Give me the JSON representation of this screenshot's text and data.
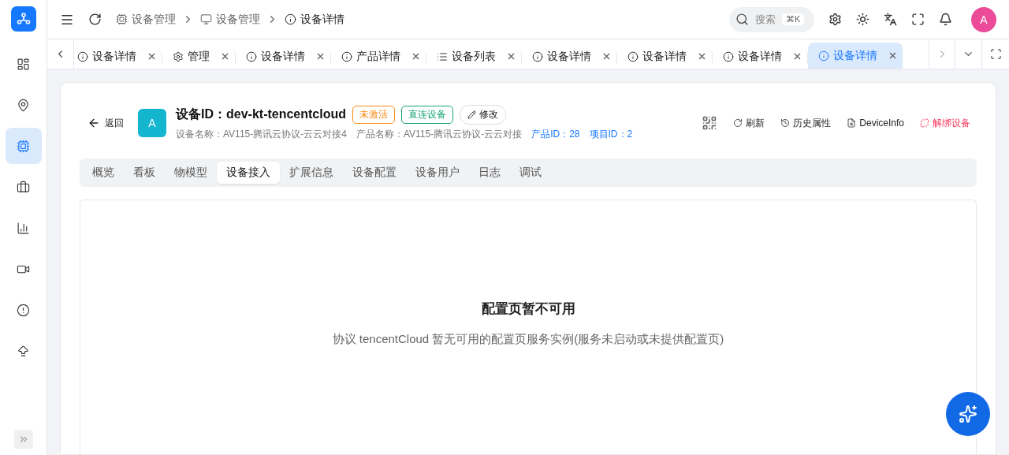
{
  "sidebar": {
    "items": [
      {
        "selected": false
      },
      {
        "selected": false
      },
      {
        "selected": true
      },
      {
        "selected": false
      },
      {
        "selected": false
      },
      {
        "selected": false
      },
      {
        "selected": false
      },
      {
        "selected": false
      }
    ]
  },
  "breadcrumb": [
    {
      "label": "设备管理"
    },
    {
      "label": "设备管理"
    },
    {
      "label": "设备详情"
    }
  ],
  "search": {
    "placeholder": "搜索",
    "shortcut": "⌘K"
  },
  "avatar": "A",
  "tabs": [
    {
      "kind": "info",
      "label": "设备详情",
      "selected": false
    },
    {
      "kind": "gear",
      "label": "管理",
      "selected": false
    },
    {
      "kind": "info",
      "label": "设备详情",
      "selected": false
    },
    {
      "kind": "info",
      "label": "产品详情",
      "selected": false
    },
    {
      "kind": "list",
      "label": "设备列表",
      "selected": false
    },
    {
      "kind": "info",
      "label": "设备详情",
      "selected": false
    },
    {
      "kind": "info",
      "label": "设备详情",
      "selected": false
    },
    {
      "kind": "info",
      "label": "设备详情",
      "selected": false
    },
    {
      "kind": "info",
      "label": "设备详情",
      "selected": true
    }
  ],
  "device": {
    "back": "返回",
    "avatar": "A",
    "title": "设备ID：dev-kt-tencentcloud",
    "badges": [
      {
        "label": "未激活",
        "color": "#fa8c16"
      },
      {
        "label": "直连设备",
        "color": "#13a472"
      }
    ],
    "edit": "修改",
    "meta": [
      {
        "text": "设备名称：AV115-腾讯云协议-云云对接4",
        "kind": "plain"
      },
      {
        "text": "产品名称：AV115-腾讯云协议-云云对接",
        "kind": "plain"
      },
      {
        "text": "产品ID：28",
        "kind": "link"
      },
      {
        "text": "项目ID：2",
        "kind": "link"
      }
    ],
    "actions": [
      {
        "label": "刷新",
        "kind": "normal"
      },
      {
        "label": "历史属性",
        "kind": "normal"
      },
      {
        "label": "DeviceInfo",
        "kind": "normal"
      },
      {
        "label": "解绑设备",
        "kind": "danger"
      }
    ]
  },
  "detail_tabs": [
    {
      "label": "概览",
      "selected": false
    },
    {
      "label": "看板",
      "selected": false
    },
    {
      "label": "物模型",
      "selected": false
    },
    {
      "label": "设备接入",
      "selected": true
    },
    {
      "label": "扩展信息",
      "selected": false
    },
    {
      "label": "设备配置",
      "selected": false
    },
    {
      "label": "设备用户",
      "selected": false
    },
    {
      "label": "日志",
      "selected": false
    },
    {
      "label": "调试",
      "selected": false
    }
  ],
  "empty": {
    "title": "配置页暂不可用",
    "message": "协议 tencentCloud 暂无可用的配置页服务实例(服务未启动或未提供配置页)"
  }
}
